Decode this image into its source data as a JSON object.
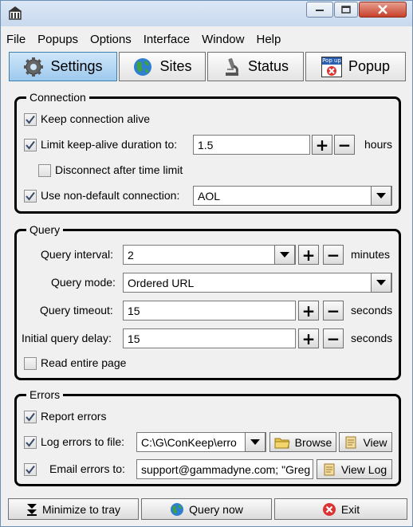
{
  "menu": [
    "File",
    "Popups",
    "Options",
    "Interface",
    "Window",
    "Help"
  ],
  "tabs": [
    "Settings",
    "Sites",
    "Status",
    "Popup"
  ],
  "popup_icon_text": "Pop up",
  "connection": {
    "title": "Connection",
    "keep_alive": {
      "label": "Keep connection alive",
      "checked": true
    },
    "limit": {
      "label": "Limit keep-alive duration to:",
      "checked": true,
      "value": "1.5",
      "unit": "hours"
    },
    "disconnect": {
      "label": "Disconnect after time limit",
      "checked": false
    },
    "nondefault": {
      "label": "Use non-default connection:",
      "checked": true,
      "value": "AOL"
    }
  },
  "query": {
    "title": "Query",
    "interval": {
      "label": "Query interval:",
      "value": "2",
      "unit": "minutes"
    },
    "mode": {
      "label": "Query mode:",
      "value": "Ordered URL"
    },
    "timeout": {
      "label": "Query timeout:",
      "value": "15",
      "unit": "seconds"
    },
    "delay": {
      "label": "Initial query delay:",
      "value": "15",
      "unit": "seconds"
    },
    "read_entire": {
      "label": "Read entire page",
      "checked": false
    }
  },
  "errors": {
    "title": "Errors",
    "report": {
      "label": "Report errors",
      "checked": true
    },
    "log": {
      "label": "Log errors to file:",
      "checked": true,
      "value": "C:\\G\\ConKeep\\erro",
      "browse": "Browse",
      "view": "View"
    },
    "email": {
      "label": "Email errors to:",
      "checked": true,
      "value": "support@gammadyne.com; \"Greg",
      "view_log": "View Log"
    }
  },
  "bottom": {
    "minimize": "Minimize to tray",
    "query_now": "Query now",
    "exit": "Exit"
  }
}
